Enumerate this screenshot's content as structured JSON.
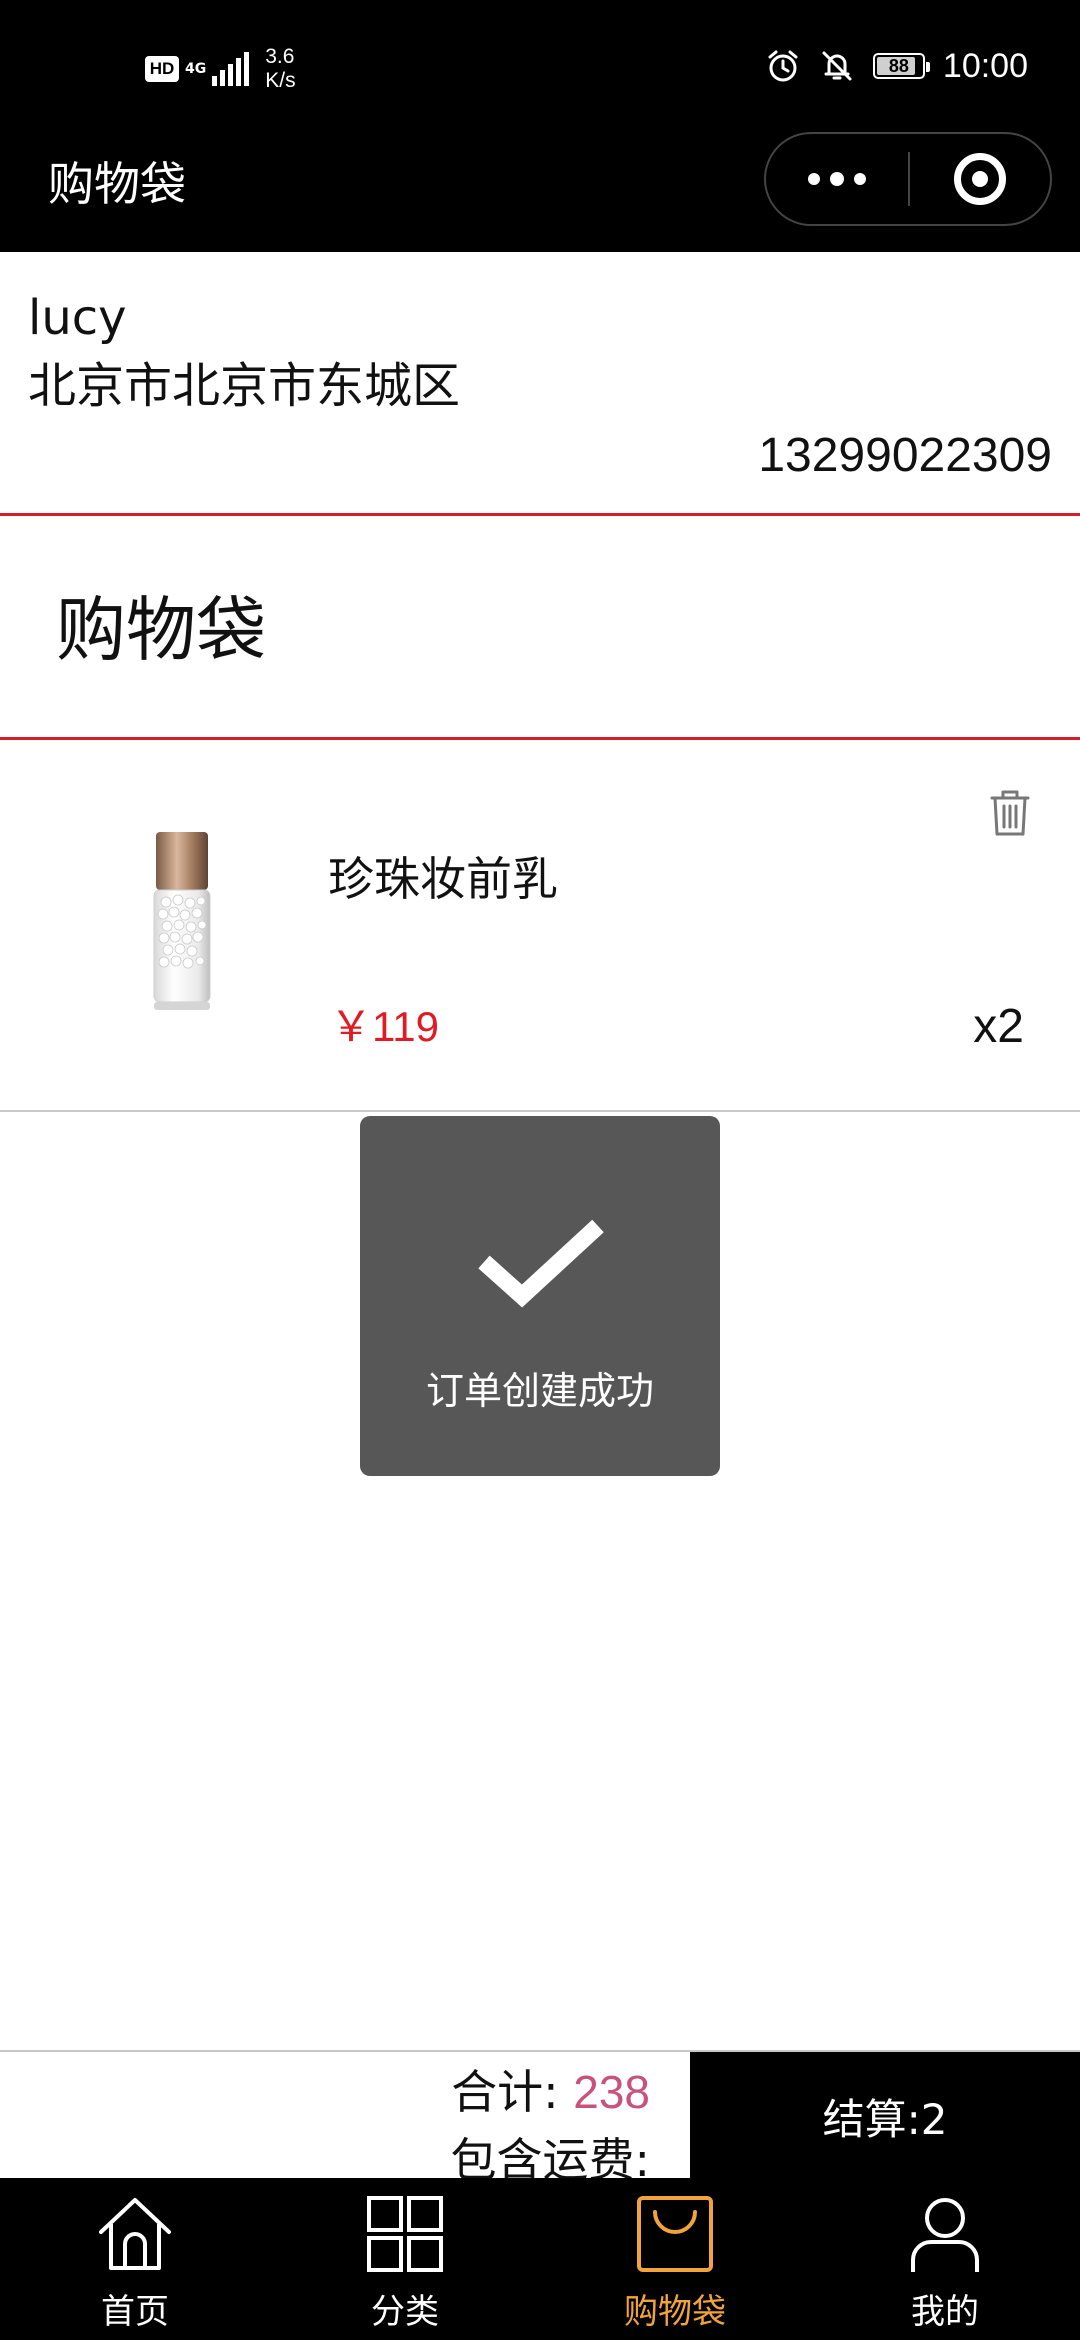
{
  "status_bar": {
    "hd": "HD",
    "network": "4G",
    "speed_value": "3.6",
    "speed_unit": "K/s",
    "battery": "88",
    "battery_level": 0.88,
    "time": "10:00",
    "icons": [
      "alarm-icon",
      "mute-icon",
      "battery-icon"
    ]
  },
  "nav": {
    "title": "购物袋"
  },
  "address": {
    "name": "lucy",
    "region": "北京市北京市东城区",
    "phone": "13299022309"
  },
  "section_title": "购物袋",
  "cart": {
    "items": [
      {
        "name": "珍珠妆前乳",
        "price": "￥119",
        "qty": "x2",
        "image": "pearl-primer-bottle"
      }
    ]
  },
  "toast": {
    "text": "订单创建成功",
    "icon": "checkmark-icon"
  },
  "summary": {
    "total_label": "合计:",
    "total_value": "238",
    "shipping_label": "包含运费:",
    "checkout_label": "结算:2"
  },
  "tabbar": {
    "tabs": [
      {
        "label": "首页",
        "icon": "home-icon"
      },
      {
        "label": "分类",
        "icon": "grid-icon"
      },
      {
        "label": "购物袋",
        "icon": "bag-icon",
        "active": true
      },
      {
        "label": "我的",
        "icon": "user-icon"
      }
    ]
  },
  "colors": {
    "accent_red": "#d11f2a",
    "price_red": "#e01b24",
    "total_pink": "#c8527a",
    "tab_active": "#f2a33c",
    "bar_black": "#000000",
    "toast_bg": "#575757"
  }
}
